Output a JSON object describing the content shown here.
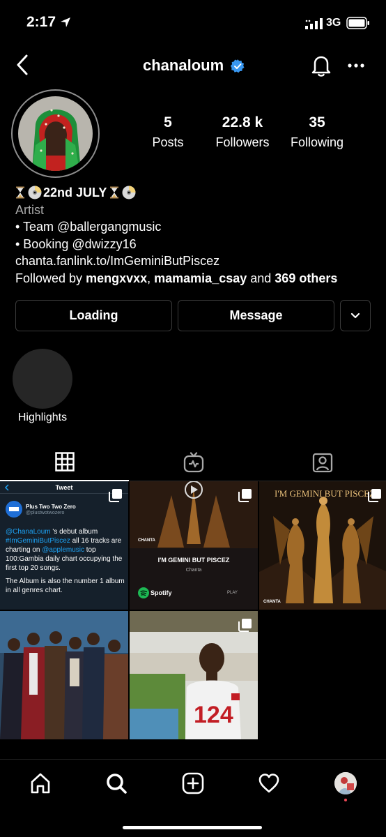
{
  "status_bar": {
    "time": "2:17",
    "network": "3G",
    "icons": [
      "location-arrow-icon",
      "signal-icon",
      "battery-icon"
    ]
  },
  "header": {
    "username": "chanaloum",
    "verified": true,
    "icons": [
      "back-icon",
      "bell-icon",
      "more-icon"
    ]
  },
  "profile": {
    "stats": [
      {
        "value": "5",
        "label": "Posts"
      },
      {
        "value": "22.8 k",
        "label": "Followers"
      },
      {
        "value": "35",
        "label": "Following"
      }
    ]
  },
  "bio": {
    "name": "22nd JULY",
    "category": "Artist",
    "lines": [
      "• Team @ballergangmusic",
      "• Booking @dwizzy16"
    ],
    "link": "chanta.fanlink.to/ImGeminiButPiscez",
    "followed_by_prefix": "Followed by ",
    "followed_by_user1": "mengxvxx",
    "followed_by_sep": ", ",
    "followed_by_user2": "mamamia_csay",
    "followed_by_and": " and ",
    "followed_by_others": "369 others"
  },
  "actions": {
    "follow_label": "Loading",
    "message_label": "Message"
  },
  "highlights": {
    "label": "Highlights"
  },
  "tabs": [
    "grid-icon",
    "igtv-icon",
    "tagged-icon"
  ],
  "posts": {
    "tweet": {
      "header": "Tweet",
      "name": "Plus Two Two Zero",
      "handle": "@plustwotwozero",
      "mention": "@ChanaLoum",
      "text1": " 's debut album ",
      "hashtag": "#ImGeminiButPiscez",
      "text2": " all 16 tracks are charting on ",
      "mention2": "@applemusic",
      "text3": " top 100:Gambia daily chart occupying the first top 20 songs.",
      "text4": "The Album is also the number 1 album in all genres chart."
    },
    "spotify": {
      "artist_tag": "CHANTA",
      "title": "I'M GEMINI BUT PISCEZ",
      "artist": "Chanta",
      "brand": "Spotify",
      "play": "PLAY"
    },
    "album": {
      "title": "I'M GEMINI BUT PISCEZ",
      "artist_tag": "CHANTA"
    }
  },
  "bottom_nav": [
    "home-icon",
    "search-icon",
    "create-icon",
    "activity-icon",
    "profile-icon"
  ],
  "colors": {
    "background": "#000000",
    "verified": "#3897f0",
    "notification_dot": "#ed4956"
  }
}
